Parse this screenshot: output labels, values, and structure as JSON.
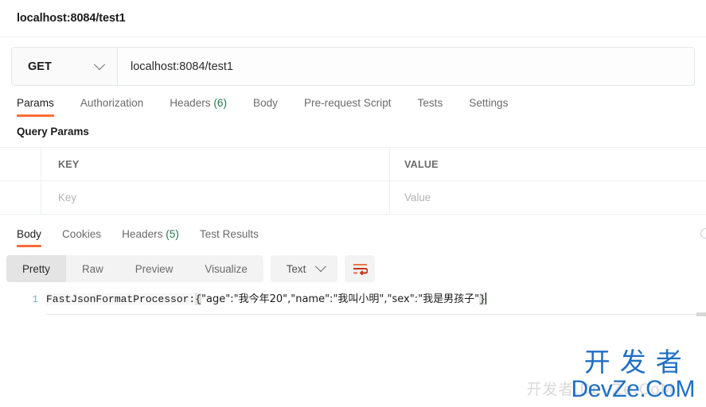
{
  "titlebar": {
    "title": "localhost:8084/test1"
  },
  "request": {
    "method": "GET",
    "url": "localhost:8084/test1",
    "tabs": [
      {
        "label": "Params",
        "active": true
      },
      {
        "label": "Authorization",
        "active": false
      },
      {
        "label": "Headers",
        "count": "(6)",
        "active": false
      },
      {
        "label": "Body",
        "active": false
      },
      {
        "label": "Pre-request Script",
        "active": false
      },
      {
        "label": "Tests",
        "active": false
      },
      {
        "label": "Settings",
        "active": false
      }
    ],
    "section_title": "Query Params",
    "table": {
      "headers": {
        "key": "KEY",
        "value": "VALUE"
      },
      "rows": [
        {
          "key_placeholder": "Key",
          "value_placeholder": "Value"
        }
      ]
    }
  },
  "response": {
    "tabs": [
      {
        "label": "Body",
        "active": true
      },
      {
        "label": "Cookies",
        "active": false
      },
      {
        "label": "Headers",
        "count": "(5)",
        "active": false
      },
      {
        "label": "Test Results",
        "active": false
      }
    ],
    "format_buttons": [
      {
        "label": "Pretty",
        "active": true
      },
      {
        "label": "Raw",
        "active": false
      },
      {
        "label": "Preview",
        "active": false
      },
      {
        "label": "Visualize",
        "active": false
      }
    ],
    "type_dropdown": "Text",
    "body": {
      "line_number": "1",
      "prefix": "FastJsonFormatProcessor:",
      "open_brace": "{",
      "content": "\"age\":\"我今年20\",\"name\":\"我叫小明\",\"sex\":\"我是男孩子\"",
      "close_brace": "}"
    }
  },
  "watermark": {
    "cn": "开发者",
    "en": "DevZe.CoM",
    "ghost": "开发者.DevZe.CoM"
  },
  "colors": {
    "accent": "#ff6c37",
    "count": "#1c7a4a",
    "watermark": "#1f6fc4"
  }
}
